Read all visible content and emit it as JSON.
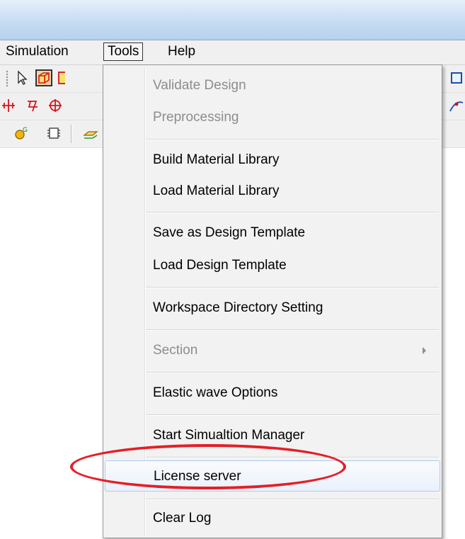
{
  "menubar": {
    "items": [
      {
        "label": "Simulation"
      },
      {
        "label": "Tools"
      },
      {
        "label": "Help"
      }
    ]
  },
  "tools_menu": {
    "items": [
      {
        "label": "Validate Design",
        "enabled": false
      },
      {
        "label": "Preprocessing",
        "enabled": false
      },
      {
        "label": "Build Material Library",
        "enabled": true
      },
      {
        "label": "Load Material Library",
        "enabled": true
      },
      {
        "label": "Save as Design Template",
        "enabled": true
      },
      {
        "label": "Load Design Template",
        "enabled": true
      },
      {
        "label": "Workspace Directory Setting",
        "enabled": true
      },
      {
        "label": "Section",
        "enabled": false,
        "has_submenu": true
      },
      {
        "label": "Elastic wave Options",
        "enabled": true
      },
      {
        "label": "Start Simualtion Manager",
        "enabled": true
      },
      {
        "label": "License server",
        "enabled": true,
        "highlighted": true
      },
      {
        "label": "Clear Log",
        "enabled": true
      }
    ]
  },
  "toolbar_icons": [
    "select-arrow-icon",
    "box-3d-icon",
    "box-3d-alt-icon",
    "snap-icon",
    "anchor-icon",
    "circle-target-icon",
    "gear-node-icon",
    "chip-icon",
    "layer-icon",
    "cube-icon",
    "curve-icon"
  ],
  "colors": {
    "annotation_red": "#e41f26",
    "hover_border": "#aecdef",
    "disabled_text": "#8d8d8d"
  }
}
